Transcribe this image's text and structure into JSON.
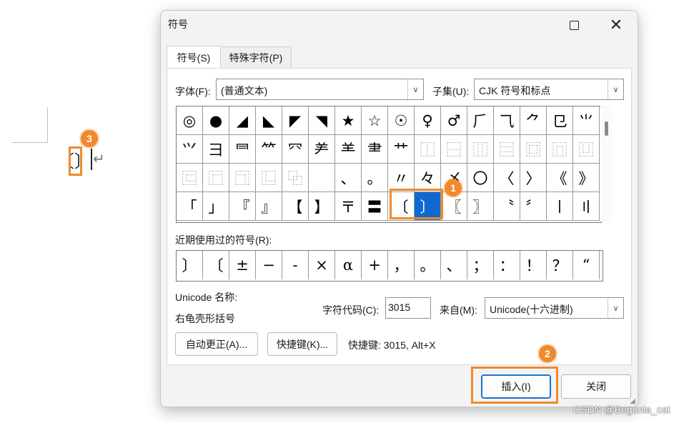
{
  "document": {
    "inserted_char": "〕",
    "paragraph_mark": "↵"
  },
  "badges": {
    "b1": "1",
    "b2": "2",
    "b3": "3"
  },
  "dialog": {
    "title": "符号",
    "tabs": [
      {
        "label": "符号(S)"
      },
      {
        "label": "特殊字符(P)"
      }
    ],
    "font": {
      "label": "字体(F):",
      "value": "(普通文本)"
    },
    "subset": {
      "label": "子集(U):",
      "value": "CJK 符号和标点"
    },
    "grid_rows": [
      [
        "◎",
        "●",
        "◢",
        "◣",
        "◤",
        "◥",
        "★",
        "☆",
        "☉",
        "♀",
        "♂",
        "⺁",
        "⺄",
        "⺈",
        "⺋",
        "⺌"
      ],
      [
        "⺍",
        "⺕",
        "⺜",
        "⺮",
        "⺳",
        "⺶",
        "⺷",
        "⺻",
        "⺾",
        "⿰",
        "⿱",
        "⿲",
        "⿳",
        "⿴",
        "⿵",
        "⿶"
      ],
      [
        "⿷",
        "⿸",
        "⿹",
        "⿺",
        "⿻",
        "",
        "、",
        "。",
        "〃",
        "々",
        "〆",
        "〇",
        "〈",
        "〉",
        "《",
        "》"
      ],
      [
        "「",
        "」",
        "『",
        "』",
        "【",
        "】",
        "〒",
        "〓",
        "〔",
        "〕",
        "〖",
        "〗",
        "〝",
        "〞",
        "〡",
        "〢"
      ]
    ],
    "recent_label": "近期使用过的符号(R):",
    "recent": [
      "〕",
      "〔",
      "±",
      "−",
      "-",
      "×",
      "α",
      "+",
      "，",
      "。",
      "、",
      "；",
      "：",
      "！",
      "？",
      "“"
    ],
    "unicode_name_label": "Unicode 名称:",
    "unicode_name": "右龟壳形括号",
    "char_code_label": "字符代码(C):",
    "char_code": "3015",
    "from_label": "来自(M):",
    "from_value": "Unicode(十六进制)",
    "autocorrect_button": "自动更正(A)...",
    "shortcut_button": "快捷键(K)...",
    "shortcut_text": "快捷键: 3015, Alt+X",
    "insert_button": "插入(I)",
    "close_button": "关闭"
  },
  "watermark": "CSDN @Begonia_cat",
  "colors": {
    "accent": "#1069d1",
    "highlight": "#f08a2c"
  }
}
